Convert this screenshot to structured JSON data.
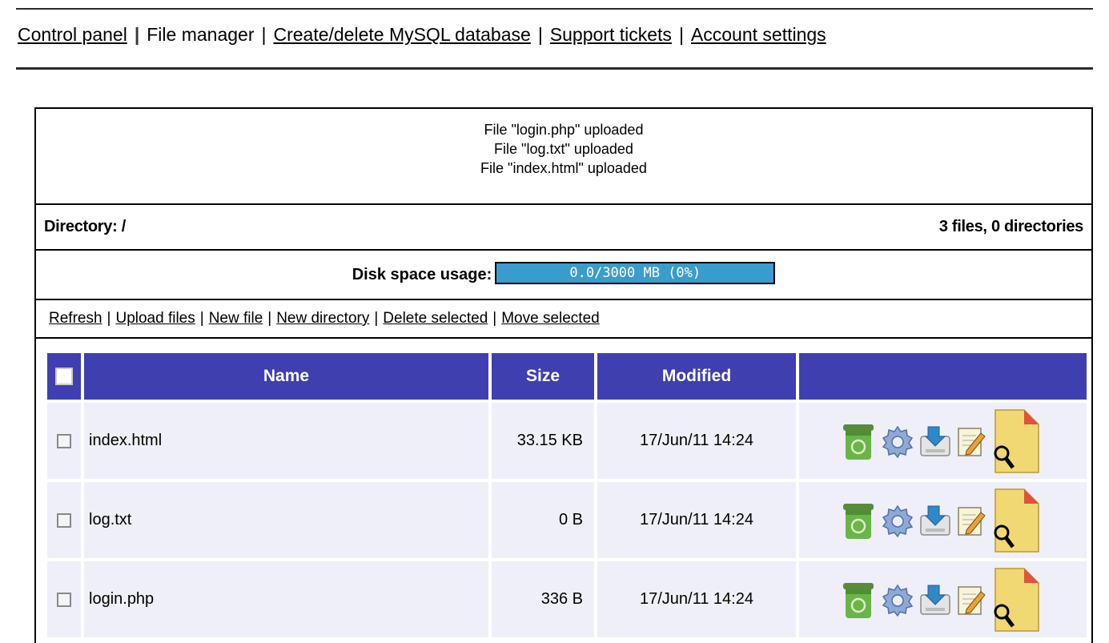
{
  "nav": {
    "items": [
      "Control panel",
      "File manager",
      "Create/delete MySQL database",
      "Support tickets",
      "Account settings"
    ],
    "separator": "|"
  },
  "messages": [
    "File \"login.php\" uploaded",
    "File \"log.txt\" uploaded",
    "File \"index.html\" uploaded"
  ],
  "directory": {
    "label": "Directory: /",
    "summary": "3 files, 0 directories"
  },
  "disk": {
    "label": "Disk space usage:",
    "text": "0.0/3000 MB (0%)",
    "percent": 0
  },
  "actions": {
    "items": [
      "Refresh",
      "Upload files",
      "New file",
      "New directory",
      "Delete selected",
      "Move selected"
    ],
    "separator": "|"
  },
  "table": {
    "headers": {
      "name": "Name",
      "size": "Size",
      "modified": "Modified"
    },
    "rows": [
      {
        "name": "index.html",
        "size": "33.15 KB",
        "modified": "17/Jun/11 14:24"
      },
      {
        "name": "log.txt",
        "size": "0 B",
        "modified": "17/Jun/11 14:24"
      },
      {
        "name": "login.php",
        "size": "336 B",
        "modified": "17/Jun/11 14:24"
      }
    ],
    "row_icons": [
      "trash-icon",
      "settings-gear-icon",
      "download-icon",
      "edit-icon",
      "view-file-icon"
    ]
  },
  "colors": {
    "header_bg": "#3f3fb0",
    "row_bg": "#eeeff8",
    "disk_bar": "#3a9ccc"
  }
}
